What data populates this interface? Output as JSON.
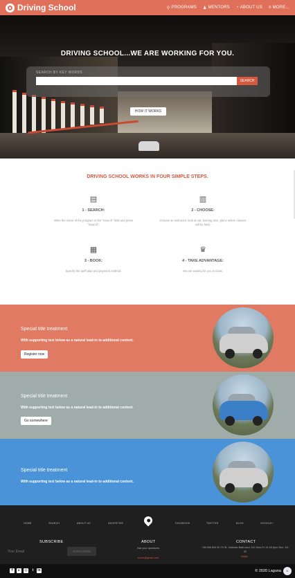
{
  "nav": {
    "brand": "Driving School",
    "items": [
      {
        "label": "PROGRAMS",
        "icon": "search-icon"
      },
      {
        "label": "MENTORS",
        "icon": "user-icon"
      },
      {
        "label": "ABOUT US",
        "icon": "rss-icon"
      },
      {
        "label": "MORE...",
        "icon": "menu-icon"
      }
    ]
  },
  "hero": {
    "title": "DRIVING SCHOOL...WE ARE WORKING FOR YOU.",
    "search_label": "SEARCH BY KEY WORDS",
    "search_placeholder": "",
    "search_button": "SEARCH",
    "how_button": "HOW IT WORKS"
  },
  "steps": {
    "title": "DRIVING SCHOOL WORKS IN FOUR SIMPLE STEPS.",
    "items": [
      {
        "icon": "newspaper-icon",
        "title": "1 - SEARCH:",
        "text": "Write the name of the program in the \"Search\" field and press \"Search\"."
      },
      {
        "icon": "map-icon",
        "title": "2 - CHOOSE:",
        "text": "Choose an instructor, look at car, training time, place where classes will be held."
      },
      {
        "icon": "document-icon",
        "title": "3 - BOOK:",
        "text": "Specify the tariff plan and payment method."
      },
      {
        "icon": "trophy-icon",
        "title": "4 - TAKE ADVANTAGE:",
        "text": "We are waiting for you in class."
      }
    ]
  },
  "bands": [
    {
      "title": "Special title treatment",
      "text": "With supporting text below as a natural lead-in to additional content.",
      "button": "Register now",
      "color": "#e07a62"
    },
    {
      "title": "Special title treatment",
      "text": "With supporting text below as a natural lead-in to additional content.",
      "button": "Go somewhere",
      "color": "#a0acaa"
    },
    {
      "title": "Special title treatment",
      "text": "With supporting text below as a natural lead-in to additional content.",
      "button": "",
      "color": "#4a93d8"
    }
  ],
  "footer": {
    "links": [
      "HOME",
      "SEARCH",
      "ABOUT US",
      "ADVERTISE",
      "FACEBOOK",
      "TWITTER",
      "BLOG",
      "GOOGLE+"
    ],
    "subscribe_title": "SUBSCRIBE",
    "email_placeholder": "Your Email",
    "subscribe_button": "SUBSCRIBE",
    "about_title": "ABOUT",
    "about_text": "Ask your questions",
    "about_email": "some@gmail.com",
    "contact_title": "CONTACT",
    "contact_text": "+38 066 805 90 79 St. Vadislav Batirovicz 142 Mon-Fri 11:00-5pm Sun: 15-20",
    "contact_link": "Maps",
    "copyright": "© 2020 Laguna",
    "fab_label": "3L"
  }
}
